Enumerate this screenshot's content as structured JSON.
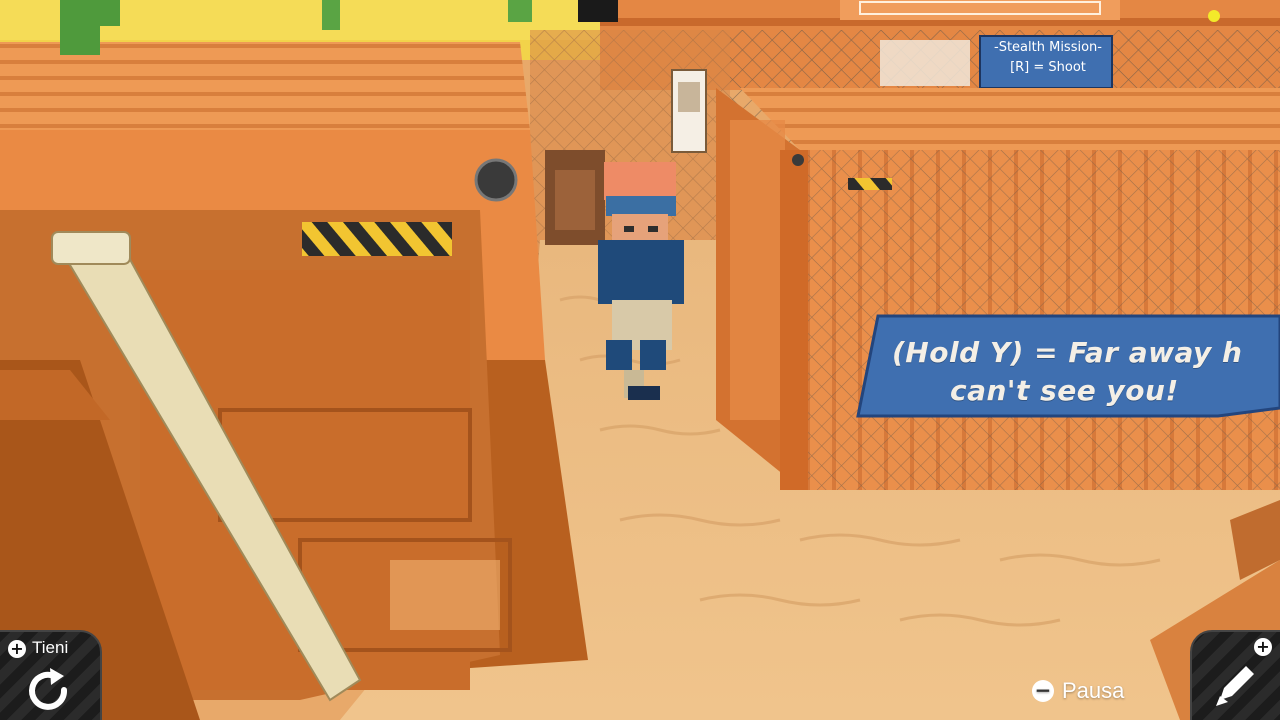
{
  "scene": {
    "colors": {
      "sand": "#e8b57a",
      "container": "#e98a45",
      "container_dark": "#b35a1f",
      "sign_blue": "#3f6fb0",
      "sky": "#f2d34a"
    }
  },
  "signs": {
    "hint_line1": "(Hold Y) = Far away h",
    "hint_line2": "can't see you!",
    "mission_line1": "-Stealth Mission-",
    "mission_line2": "[R] = Shoot"
  },
  "hud": {
    "hold_label": "Tieni",
    "hold_icon": "rotate-icon",
    "pause_label": "Pausa",
    "pause_icon": "minus-button-icon",
    "edit_icon": "pencil-icon",
    "plus_symbol": "+",
    "minus_symbol": "−"
  }
}
